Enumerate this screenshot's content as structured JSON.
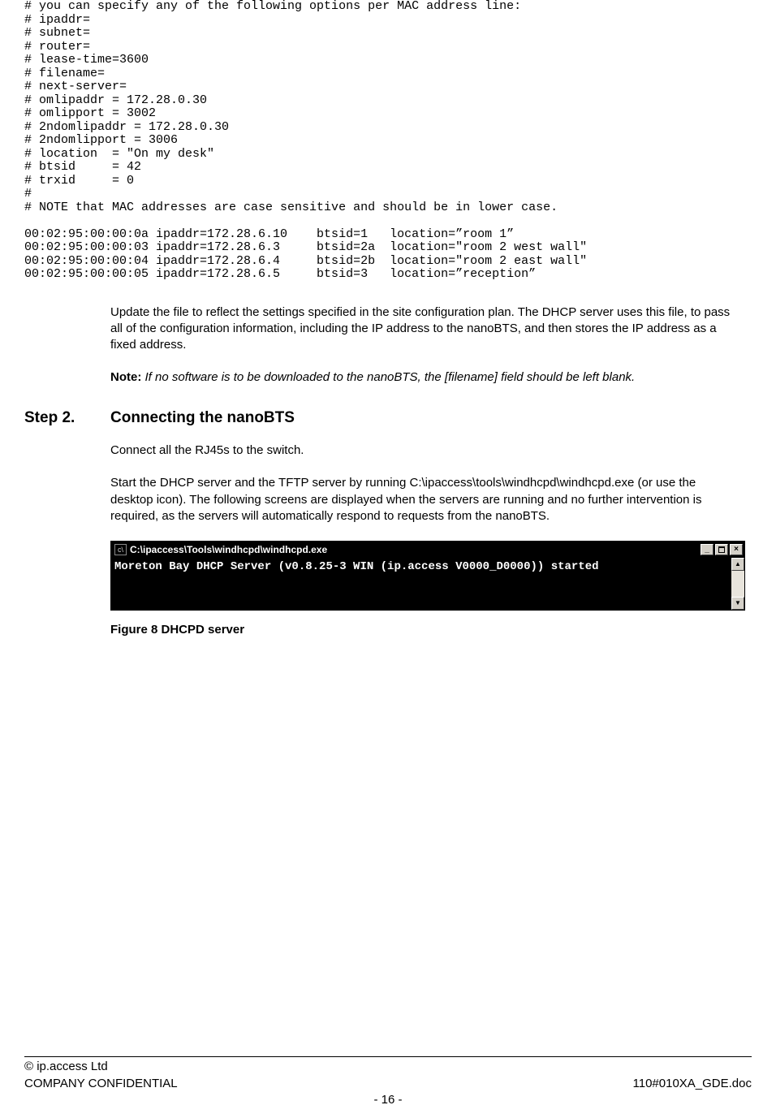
{
  "code_block": "# you can specify any of the following options per MAC address line:\n# ipaddr=\n# subnet=\n# router=\n# lease-time=3600\n# filename=\n# next-server=\n# omlipaddr = 172.28.0.30\n# omlipport = 3002\n# 2ndomlipaddr = 172.28.0.30\n# 2ndomlipport = 3006\n# location  = \"On my desk\"\n# btsid     = 42\n# trxid     = 0\n#\n# NOTE that MAC addresses are case sensitive and should be in lower case.\n\n00:02:95:00:00:0a ipaddr=172.28.6.10    btsid=1   location=”room 1”\n00:02:95:00:00:03 ipaddr=172.28.6.3     btsid=2a  location=\"room 2 west wall\"\n00:02:95:00:00:04 ipaddr=172.28.6.4     btsid=2b  location=\"room 2 east wall\"\n00:02:95:00:00:05 ipaddr=172.28.6.5     btsid=3   location=”reception”",
  "para_update": "Update the file to reflect the settings specified in the site configuration plan. The DHCP server uses this file, to pass all of the configuration information, including the IP address to the nanoBTS, and then stores the IP address as a fixed address.",
  "note_label": "Note:",
  "note_body": " If no software is to be downloaded to the nanoBTS, the [filename] field should be left blank.",
  "step2_num": "Step 2.",
  "step2_title": "Connecting the nanoBTS",
  "para_connect": "Connect all the RJ45s to the switch.",
  "para_start": "Start the DHCP server and the TFTP server by running C:\\ipaccess\\tools\\windhcpd\\windhcpd.exe (or use the desktop icon). The following screens are displayed when the servers are running and no further intervention is required, as the servers will automatically respond to requests from the nanoBTS.",
  "screenshot": {
    "titlebar": "C:\\ipaccess\\Tools\\windhcpd\\windhcpd.exe",
    "console_line": "Moreton Bay DHCP Server (v0.8.25-3 WIN (ip.access V0000_D0000)) started"
  },
  "figure_caption": "Figure 8 DHCPD server",
  "footer": {
    "copyright": "© ip.access Ltd",
    "confidential": "COMPANY CONFIDENTIAL",
    "doc_ref": "110#010XA_GDE.doc",
    "page": "- 16 -"
  }
}
